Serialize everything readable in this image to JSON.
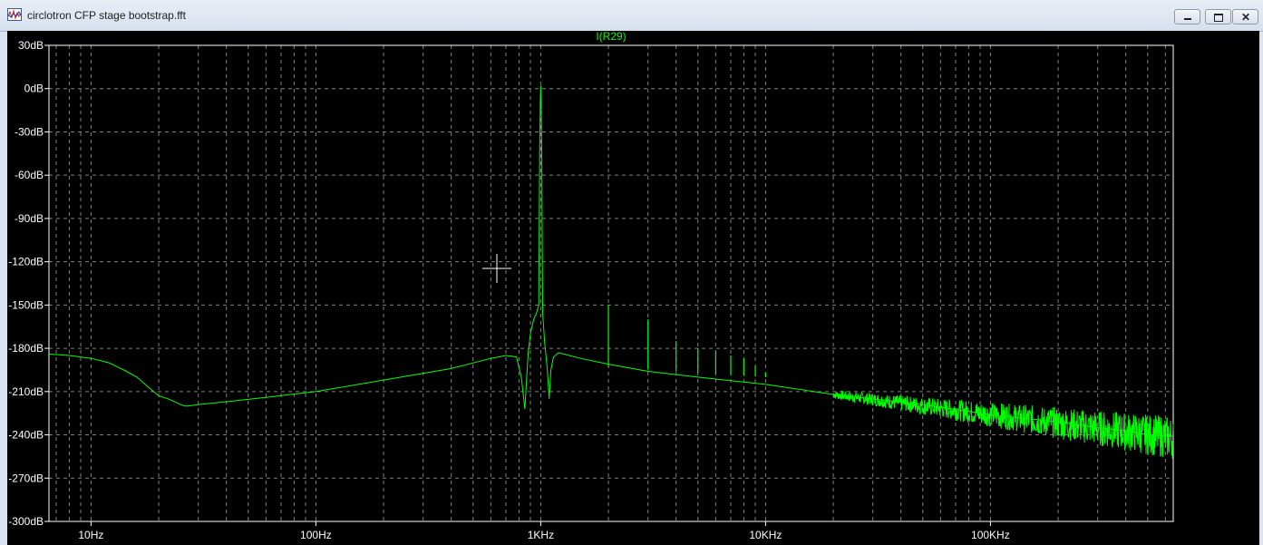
{
  "window": {
    "title": "circlotron CFP stage bootstrap.fft",
    "icon": "waveform-icon",
    "controls": {
      "minimize": "minimize-icon",
      "maximize": "maximize-icon",
      "close": "close-icon",
      "close_glyph": "✕"
    }
  },
  "colors": {
    "background": "#000000",
    "trace": "#00ff00",
    "grid": "#808080",
    "tick_text": "#ffffff"
  },
  "chart_data": {
    "type": "line",
    "title": "",
    "xlabel": "",
    "ylabel": "",
    "x_scale": "log",
    "xlim": [
      6.5,
      650000
    ],
    "ylim": [
      -300,
      30
    ],
    "grid": true,
    "cursor": "crosshair",
    "y_ticks": [
      30,
      0,
      -30,
      -60,
      -90,
      -120,
      -150,
      -180,
      -210,
      -240,
      -270,
      -300
    ],
    "y_tick_labels": [
      "30dB",
      "0dB",
      "-30dB",
      "-60dB",
      "-90dB",
      "-120dB",
      "-150dB",
      "-180dB",
      "-210dB",
      "-240dB",
      "-270dB",
      "-300dB"
    ],
    "x_ticks": [
      10,
      100,
      1000,
      10000,
      100000
    ],
    "x_tick_labels": [
      "10Hz",
      "100Hz",
      "1KHz",
      "10KHz",
      "100KHz"
    ],
    "series": [
      {
        "name": "I(R29)",
        "color": "#00ff00",
        "x": [
          6.5,
          8,
          10,
          12,
          14,
          16,
          18,
          20,
          22,
          25,
          26,
          27,
          30,
          40,
          60,
          100,
          200,
          400,
          600,
          700,
          780,
          820,
          850,
          870,
          880,
          900,
          930,
          960,
          980,
          990,
          995,
          1000,
          1005,
          1010,
          1020,
          1040,
          1070,
          1090,
          1110,
          1140,
          1200,
          1500,
          2000,
          3000,
          5000,
          10000,
          20000,
          50000,
          100000,
          200000,
          300000,
          400000,
          500000,
          650000
        ],
        "y": [
          -184,
          -185,
          -187,
          -190,
          -195,
          -200,
          -207,
          -213,
          -215,
          -219,
          -220,
          -220,
          -219,
          -217,
          -214,
          -210,
          -202,
          -194,
          -187,
          -185,
          -186,
          -200,
          -222,
          -195,
          -183,
          -170,
          -160,
          -155,
          -150,
          -40,
          -10,
          2,
          -10,
          -40,
          -155,
          -175,
          -195,
          -215,
          -195,
          -186,
          -183,
          -187,
          -191,
          -196,
          -200,
          -205,
          -212,
          -219,
          -226,
          -231,
          -235,
          -237,
          -240,
          -241
        ]
      }
    ],
    "harmonic_spurs": {
      "frequencies": [
        2000,
        3000,
        4000,
        5000,
        6000,
        7000,
        8000,
        9000,
        10000
      ],
      "peak_db": [
        -150,
        -160,
        -175,
        -180,
        -182,
        -185,
        -187,
        -192,
        -197
      ]
    }
  }
}
